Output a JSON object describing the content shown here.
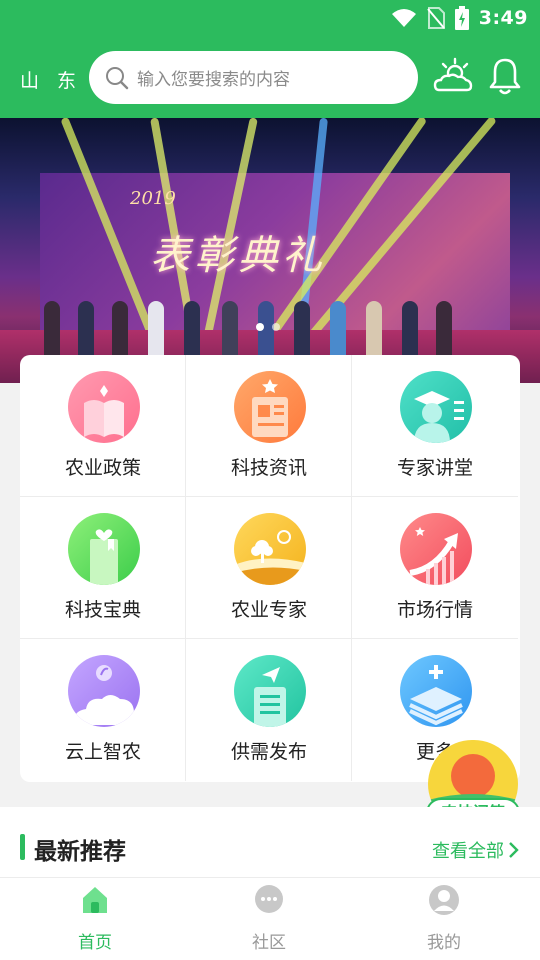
{
  "status_bar": {
    "time": "3:49"
  },
  "header": {
    "location": "山 东",
    "search_placeholder": "输入您要搜索的内容"
  },
  "banner": {
    "year": "2019",
    "title": "表彰典礼"
  },
  "grid": {
    "items": [
      {
        "label": "农业政策",
        "icon": "policy-book-icon"
      },
      {
        "label": "科技资讯",
        "icon": "news-icon"
      },
      {
        "label": "专家讲堂",
        "icon": "lecture-icon"
      },
      {
        "label": "科技宝典",
        "icon": "handbook-icon"
      },
      {
        "label": "农业专家",
        "icon": "expert-icon"
      },
      {
        "label": "市场行情",
        "icon": "market-trend-icon"
      },
      {
        "label": "云上智农",
        "icon": "cloud-farm-icon"
      },
      {
        "label": "供需发布",
        "icon": "supply-demand-icon"
      },
      {
        "label": "更多",
        "icon": "more-icon"
      }
    ]
  },
  "float_button": {
    "label": "农技问答"
  },
  "recommend": {
    "title": "最新推荐",
    "more_label": "查看全部"
  },
  "tabbar": {
    "tabs": [
      {
        "label": "首页",
        "active": true
      },
      {
        "label": "社区",
        "active": false
      },
      {
        "label": "我的",
        "active": false
      }
    ]
  },
  "colors": {
    "primary": "#2cbb5e"
  }
}
